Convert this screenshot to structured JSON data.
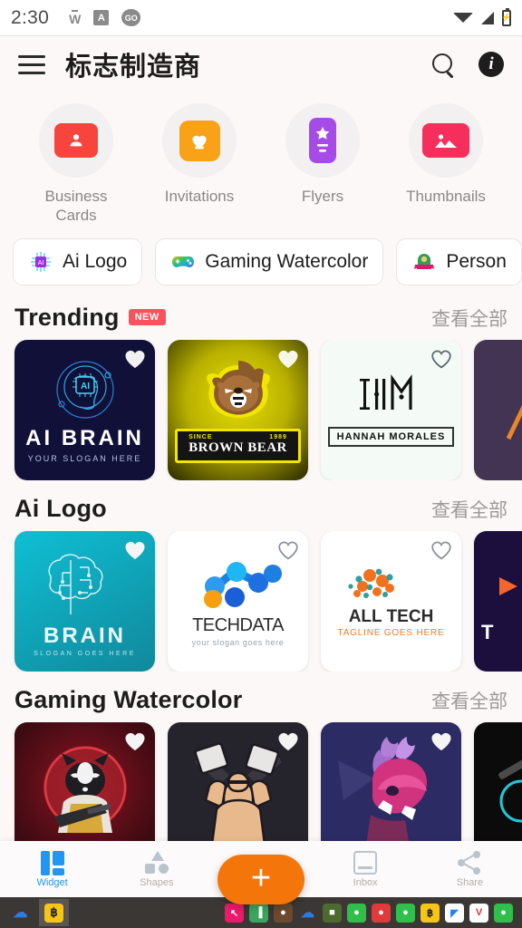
{
  "status_bar": {
    "time": "2:30",
    "notif_icons": [
      "w-icon",
      "a-badge-icon",
      "go-icon"
    ],
    "right_icons": [
      "wifi-icon",
      "signal-icon",
      "battery-charging-icon"
    ],
    "battery_glyph": "⚡"
  },
  "app_bar": {
    "menu_icon": "hamburger-menu-icon",
    "title": "标志制造商",
    "search_icon": "search-icon",
    "info_icon": "info-icon",
    "info_glyph": "i"
  },
  "categories": [
    {
      "label": "Business Cards",
      "icon": "business-card-icon",
      "color": "#F7443C",
      "glyph": "👤"
    },
    {
      "label": "Invitations",
      "icon": "invitation-heart-icon",
      "color": "#F9A218",
      "glyph": "♥"
    },
    {
      "label": "Flyers",
      "icon": "flyer-star-icon",
      "color": "#A74BE8",
      "glyph": "★"
    },
    {
      "label": "Thumbnails",
      "icon": "thumbnail-image-icon",
      "color": "#F62E5C",
      "glyph": "🏔"
    }
  ],
  "chips": [
    {
      "label": "Ai Logo",
      "icon": "ai-chip-icon"
    },
    {
      "label": "Gaming Watercolor",
      "icon": "gamepad-icon"
    },
    {
      "label": "Person",
      "icon": "person-badge-icon"
    }
  ],
  "see_all_label": "查看全部",
  "new_badge": "NEW",
  "sections": [
    {
      "title": "Trending",
      "has_new_badge": true,
      "cards": [
        {
          "name": "AI BRAIN",
          "slogan": "YOUR SLOGAN HERE",
          "style": "c-navy",
          "favorited": true
        },
        {
          "name": "BROWN BEAR",
          "since": "SINCE",
          "year": "1989",
          "style": "c-yellow",
          "favorited": true
        },
        {
          "name": "HANNAH MORALES",
          "monogram": "I·|M",
          "style": "c-mint",
          "favorited": false
        },
        {
          "name": "",
          "style": "c-purple",
          "favorited": false
        }
      ]
    },
    {
      "title": "Ai Logo",
      "has_new_badge": false,
      "cards": [
        {
          "name": "BRAIN",
          "slogan": "SLOGAN GOES HERE",
          "style": "c-teal",
          "favorited": true
        },
        {
          "name": "TECH",
          "name2": "DATA",
          "slogan": "your slogan goes here",
          "style": "c-white",
          "favorited": false
        },
        {
          "name": "ALL TECH",
          "slogan": "TAGLINE GOES HERE",
          "style": "c-white",
          "favorited": false
        },
        {
          "name": "T",
          "style": "c-darkpurple",
          "favorited": false
        }
      ]
    },
    {
      "title": "Gaming Watercolor",
      "has_new_badge": false,
      "cards": [
        {
          "name": "raccoon-gunner-mascot",
          "style": "c-red",
          "favorited": true
        },
        {
          "name": "bodybuilder-mascot",
          "style": "c-dark",
          "favorited": true
        },
        {
          "name": "dragon-mascot",
          "style": "c-navy2",
          "favorited": true
        },
        {
          "name": "esports-mascot",
          "style": "c-black",
          "favorited": false
        }
      ]
    }
  ],
  "bottom_nav": {
    "items": [
      {
        "label": "Widget",
        "icon": "grid-icon",
        "active": true
      },
      {
        "label": "Shapes",
        "icon": "shapes-icon",
        "active": false
      },
      {
        "label": "Inbox",
        "icon": "inbox-icon",
        "active": false
      },
      {
        "label": "Share",
        "icon": "share-icon",
        "active": false
      }
    ],
    "fab": {
      "label": "+",
      "icon": "add-icon",
      "color": "#F4760B"
    }
  },
  "taskbar": {
    "left_items": [
      {
        "icon": "cloud-drive-icon",
        "color": "#2C7BE5",
        "glyph": "☁"
      },
      {
        "icon": "app-yellow-icon",
        "color": "#F5C518",
        "glyph": "฿"
      }
    ],
    "tray_items": [
      {
        "icon": "pink-app-icon",
        "color": "#EC1A6B",
        "glyph": "↖"
      },
      {
        "icon": "green-grid-icon",
        "color": "#3BA55D",
        "glyph": "▐"
      },
      {
        "icon": "avatar-icon",
        "color": "#6B4A2F",
        "glyph": "●"
      },
      {
        "icon": "cloud-icon",
        "color": "#2C7BE5",
        "glyph": "☁"
      },
      {
        "icon": "camo-icon",
        "color": "#4E6B2F",
        "glyph": "■"
      },
      {
        "icon": "green-chat-icon",
        "color": "#2FBF4A",
        "glyph": "●"
      },
      {
        "icon": "red-circle-icon",
        "color": "#E03A3A",
        "glyph": "●"
      },
      {
        "icon": "green-chat2-icon",
        "color": "#2FBF4A",
        "glyph": "●"
      },
      {
        "icon": "yellow-app-icon",
        "color": "#F5C518",
        "glyph": "฿"
      },
      {
        "icon": "blue-flag-icon",
        "color": "#1F86E8",
        "glyph": "◤"
      },
      {
        "icon": "red-v-icon",
        "color": "#D9342B",
        "glyph": "V"
      },
      {
        "icon": "green-chat3-icon",
        "color": "#2FBF4A",
        "glyph": "●"
      }
    ]
  }
}
